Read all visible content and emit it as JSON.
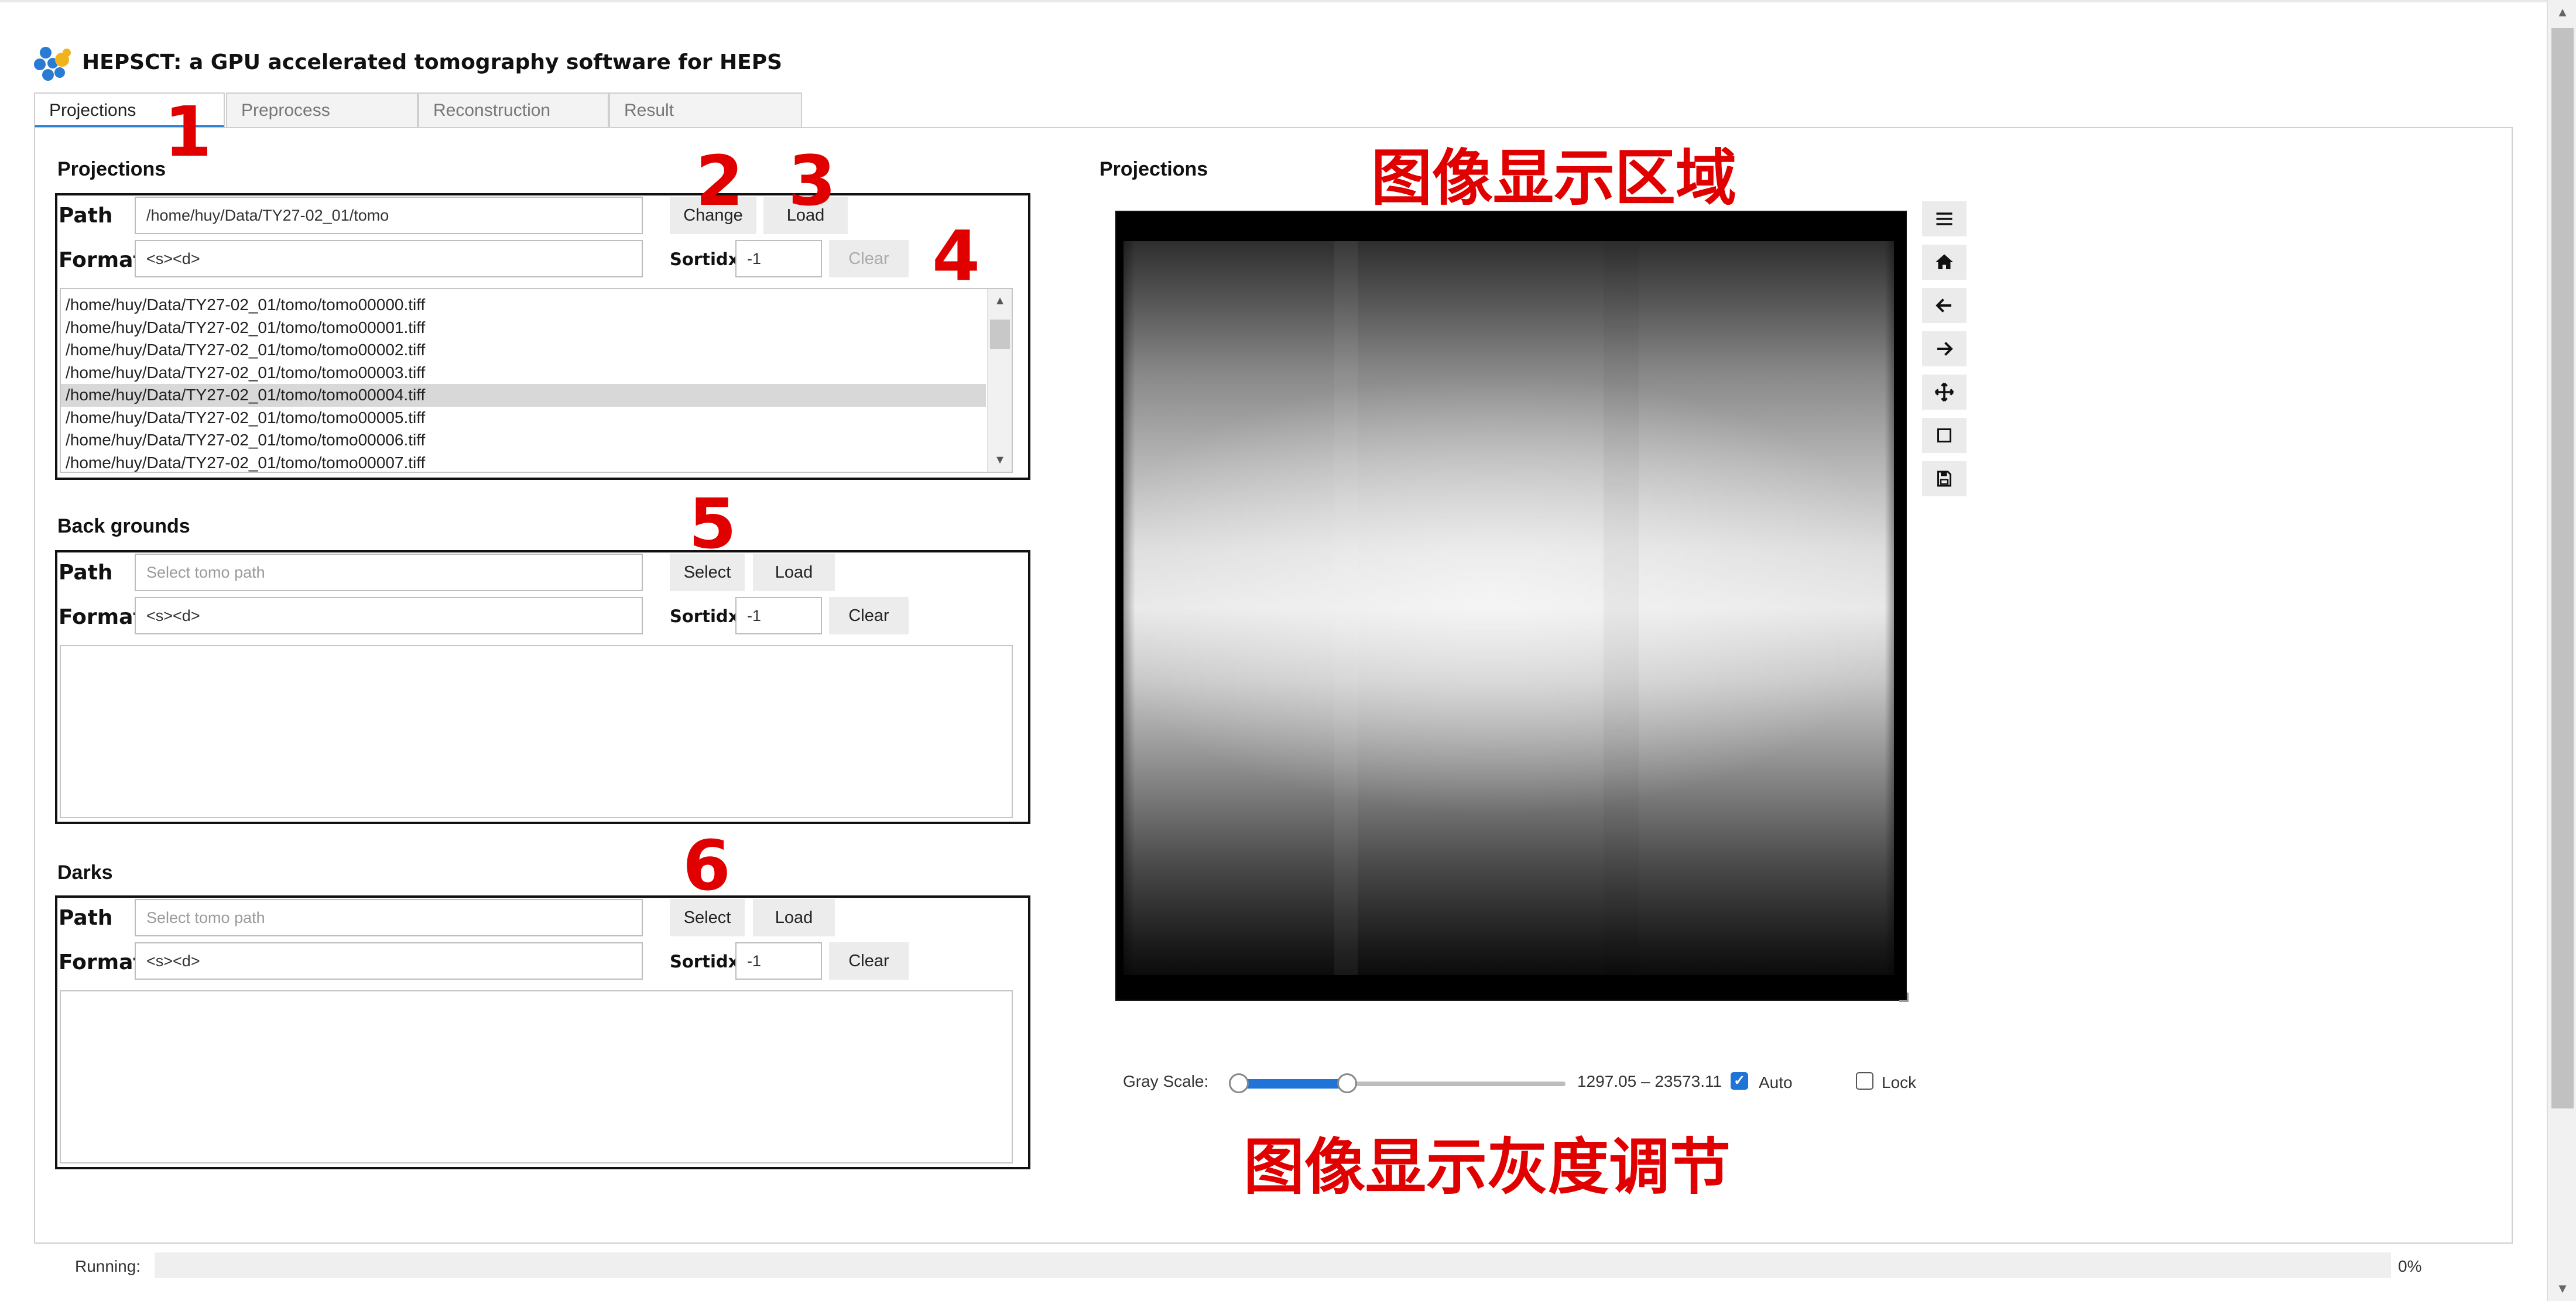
{
  "app": {
    "title": "HEPSCT: a GPU accelerated tomography software for HEPS"
  },
  "tabs": [
    {
      "label": "Projections",
      "active": true
    },
    {
      "label": "Preprocess",
      "active": false
    },
    {
      "label": "Reconstruction",
      "active": false
    },
    {
      "label": "Result",
      "active": false
    }
  ],
  "projections": {
    "title": "Projections",
    "path_label": "Path",
    "path_value": "/home/huy/Data/TY27-02_01/tomo",
    "change_button": "Change",
    "load_button": "Load",
    "format_label": "Format",
    "format_value": "<s><d>",
    "sortidx_label": "Sortidx",
    "sortidx_value": "-1",
    "clear_button": "Clear",
    "files": [
      "/home/huy/Data/TY27-02_01/tomo/tomo00000.tiff",
      "/home/huy/Data/TY27-02_01/tomo/tomo00001.tiff",
      "/home/huy/Data/TY27-02_01/tomo/tomo00002.tiff",
      "/home/huy/Data/TY27-02_01/tomo/tomo00003.tiff",
      "/home/huy/Data/TY27-02_01/tomo/tomo00004.tiff",
      "/home/huy/Data/TY27-02_01/tomo/tomo00005.tiff",
      "/home/huy/Data/TY27-02_01/tomo/tomo00006.tiff",
      "/home/huy/Data/TY27-02_01/tomo/tomo00007.tiff"
    ],
    "selected_index": 4
  },
  "backgrounds": {
    "title": "Back grounds",
    "path_label": "Path",
    "path_placeholder": "Select tomo path",
    "select_button": "Select",
    "load_button": "Load",
    "format_label": "Format",
    "format_value": "<s><d>",
    "sortidx_label": "Sortidx",
    "sortidx_value": "-1",
    "clear_button": "Clear"
  },
  "darks": {
    "title": "Darks",
    "path_label": "Path",
    "path_placeholder": "Select tomo path",
    "select_button": "Select",
    "load_button": "Load",
    "format_label": "Format",
    "format_value": "<s><d>",
    "sortidx_label": "Sortidx",
    "sortidx_value": "-1",
    "clear_button": "Clear"
  },
  "viewer": {
    "title": "Projections",
    "toolbar_icons": [
      "menu-icon",
      "home-icon",
      "arrow-left-icon",
      "arrow-right-icon",
      "move-icon",
      "square-icon",
      "save-icon"
    ],
    "gray_scale_label": "Gray Scale:",
    "gray_range": "1297.05 – 23573.11",
    "gray_min_fraction": 0.0,
    "gray_max_fraction": 0.35,
    "auto_label": "Auto",
    "auto_checked": true,
    "lock_label": "Lock",
    "lock_checked": false
  },
  "annotations": {
    "n1": "1",
    "n2": "2",
    "n3": "3",
    "n4": "4",
    "n5": "5",
    "n6": "6",
    "image_area": "图像显示区域",
    "gray_adjust": "图像显示灰度调节"
  },
  "status": {
    "running_label": "Running:",
    "progress_percent": "0%",
    "progress_value": 0
  },
  "colors": {
    "accent": "#1f74d6",
    "annotation": "#e00000"
  }
}
